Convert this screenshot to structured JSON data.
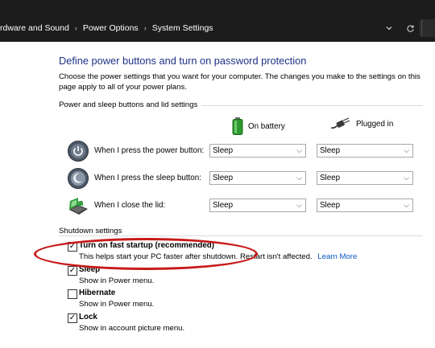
{
  "breadcrumb": {
    "items": [
      "rdware and Sound",
      "Power Options",
      "System Settings"
    ],
    "separator": "›"
  },
  "addressbar": {
    "dropdown_icon": "chevron-down-icon",
    "refresh_icon": "refresh-icon"
  },
  "main": {
    "title": "Define power buttons and turn on password protection",
    "description": "Choose the power settings that you want for your computer. The changes you make to the settings on this page apply to all of your power plans.",
    "power_section": {
      "label": "Power and sleep buttons and lid settings",
      "columns": [
        {
          "label": "On battery",
          "icon": "battery-icon"
        },
        {
          "label": "Plugged in",
          "icon": "power-plug-icon"
        }
      ],
      "rows": [
        {
          "label": "When I press the power button:",
          "icon": "power-button-icon",
          "battery": "Sleep",
          "plugged": "Sleep"
        },
        {
          "label": "When I press the sleep button:",
          "icon": "sleep-button-icon",
          "battery": "Sleep",
          "plugged": "Sleep"
        },
        {
          "label": "When I close the lid:",
          "icon": "laptop-lid-icon",
          "battery": "Sleep",
          "plugged": "Sleep"
        }
      ]
    },
    "shutdown_section": {
      "label": "Shutdown settings",
      "items": [
        {
          "title": "Turn on fast startup (recommended)",
          "desc": "This helps start your PC faster after shutdown. Restart isn't affected.",
          "link": "Learn More",
          "checked": true
        },
        {
          "title": "Sleep",
          "desc": "Show in Power menu.",
          "checked": true
        },
        {
          "title": "Hibernate",
          "desc": "Show in Power menu.",
          "checked": false
        },
        {
          "title": "Lock",
          "desc": "Show in account picture menu.",
          "checked": true
        }
      ]
    }
  },
  "colors": {
    "title": "#1e3287",
    "link": "#0a58c2",
    "annotation": "#c81a1a",
    "addressbar": "#1c1c1c"
  }
}
